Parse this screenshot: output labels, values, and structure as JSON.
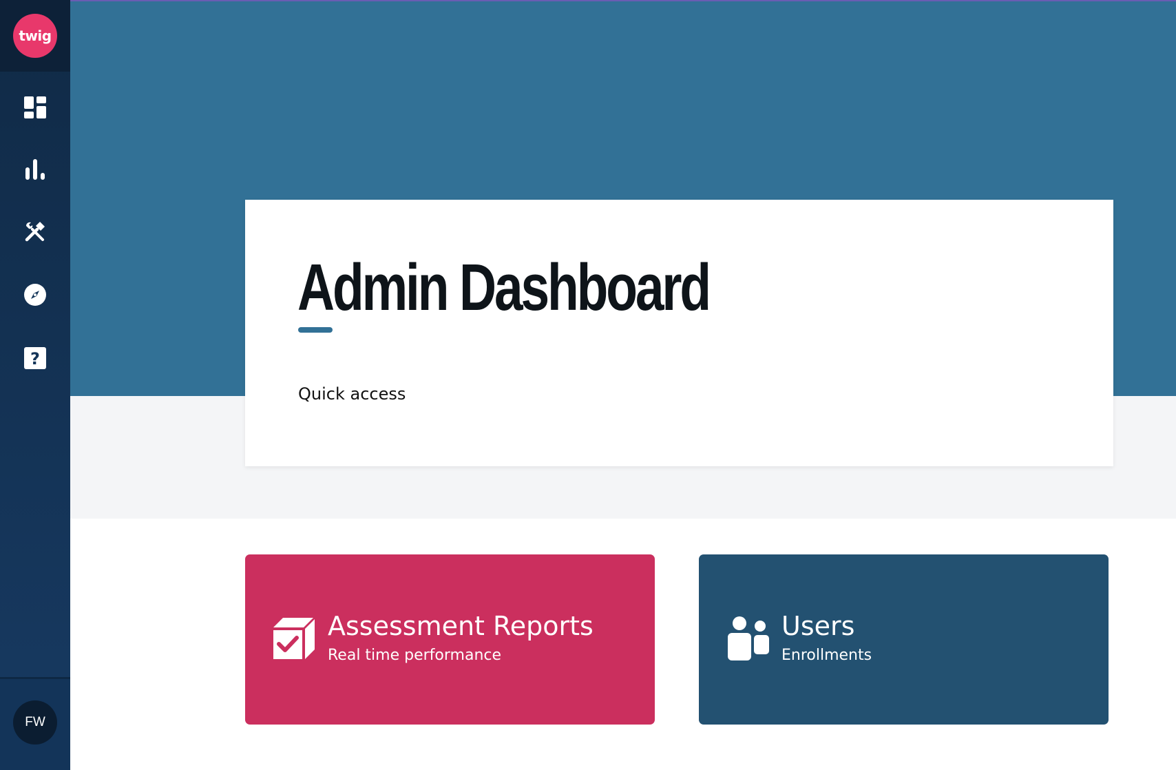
{
  "brand": {
    "logo_text": "twig",
    "logo_color": "#e8386b"
  },
  "sidebar": {
    "items": [
      {
        "icon": "dashboard-icon"
      },
      {
        "icon": "bar-chart-icon"
      },
      {
        "icon": "tools-icon"
      },
      {
        "icon": "compass-icon"
      },
      {
        "icon": "help-icon"
      }
    ],
    "user_initials": "FW"
  },
  "header": {
    "title": "Admin Dashboard",
    "section_label": "Quick access",
    "band_color": "#327196"
  },
  "tiles": [
    {
      "title": "Assessment Reports",
      "subtitle": "Real time performance",
      "icon": "assessment-box-check-icon",
      "color": "#cb2f5e"
    },
    {
      "title": "Users",
      "subtitle": "Enrollments",
      "icon": "users-icon",
      "color": "#235171"
    }
  ]
}
